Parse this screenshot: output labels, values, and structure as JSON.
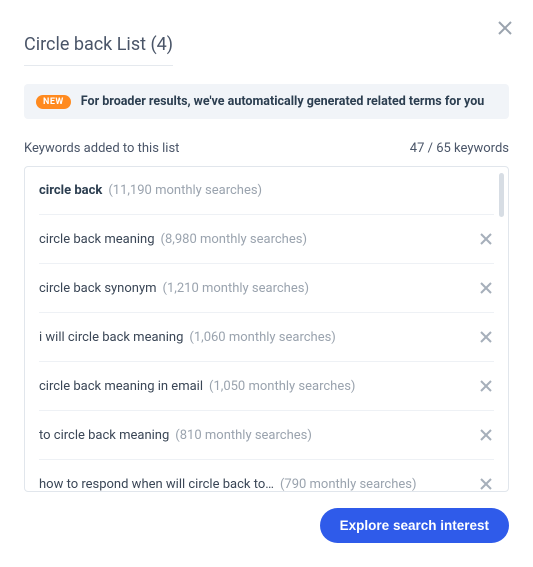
{
  "title": "Circle back List (4)",
  "banner": {
    "badge": "NEW",
    "text": "For broader results, we've automatically generated related terms for you"
  },
  "subhead": {
    "label": "Keywords added to this list",
    "count": "47 / 65 keywords"
  },
  "keywords": [
    {
      "term": "circle back",
      "stat": "(11,190 monthly searches)",
      "bold": true,
      "removable": false
    },
    {
      "term": "circle back meaning",
      "stat": "(8,980 monthly searches)",
      "bold": false,
      "removable": true
    },
    {
      "term": "circle back synonym",
      "stat": "(1,210 monthly searches)",
      "bold": false,
      "removable": true
    },
    {
      "term": "i will circle back meaning",
      "stat": "(1,060 monthly searches)",
      "bold": false,
      "removable": true
    },
    {
      "term": "circle back meaning in email",
      "stat": "(1,050 monthly searches)",
      "bold": false,
      "removable": true
    },
    {
      "term": "to circle back meaning",
      "stat": "(810 monthly searches)",
      "bold": false,
      "removable": true
    },
    {
      "term": "how to respond when will circle back to…",
      "stat": "(790 monthly searches)",
      "bold": false,
      "removable": true
    }
  ],
  "cta": "Explore search interest"
}
